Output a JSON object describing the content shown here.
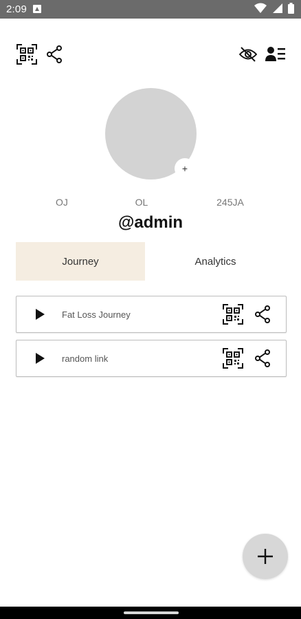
{
  "status_bar": {
    "time": "2:09",
    "icons": [
      "notification-icon",
      "wifi-icon",
      "signal-icon",
      "battery-icon"
    ]
  },
  "toolbar": {
    "left_icons": [
      "qr-code-icon",
      "share-icon"
    ],
    "right_icons": [
      "visibility-off-icon",
      "contact-list-icon"
    ]
  },
  "profile": {
    "avatar_add_label": "+",
    "stats": [
      "OJ",
      "OL",
      "245JA"
    ],
    "username": "@admin"
  },
  "tabs": [
    {
      "label": "Journey",
      "active": true
    },
    {
      "label": "Analytics",
      "active": false
    }
  ],
  "links": [
    {
      "title": "Fat Loss Journey"
    },
    {
      "title": "random link"
    }
  ],
  "fab": {
    "icon": "plus-icon"
  },
  "colors": {
    "status_bar": "#6b6b6b",
    "avatar": "#d3d3d3",
    "active_tab": "#f5ede1",
    "fab": "#d7d7d7"
  }
}
